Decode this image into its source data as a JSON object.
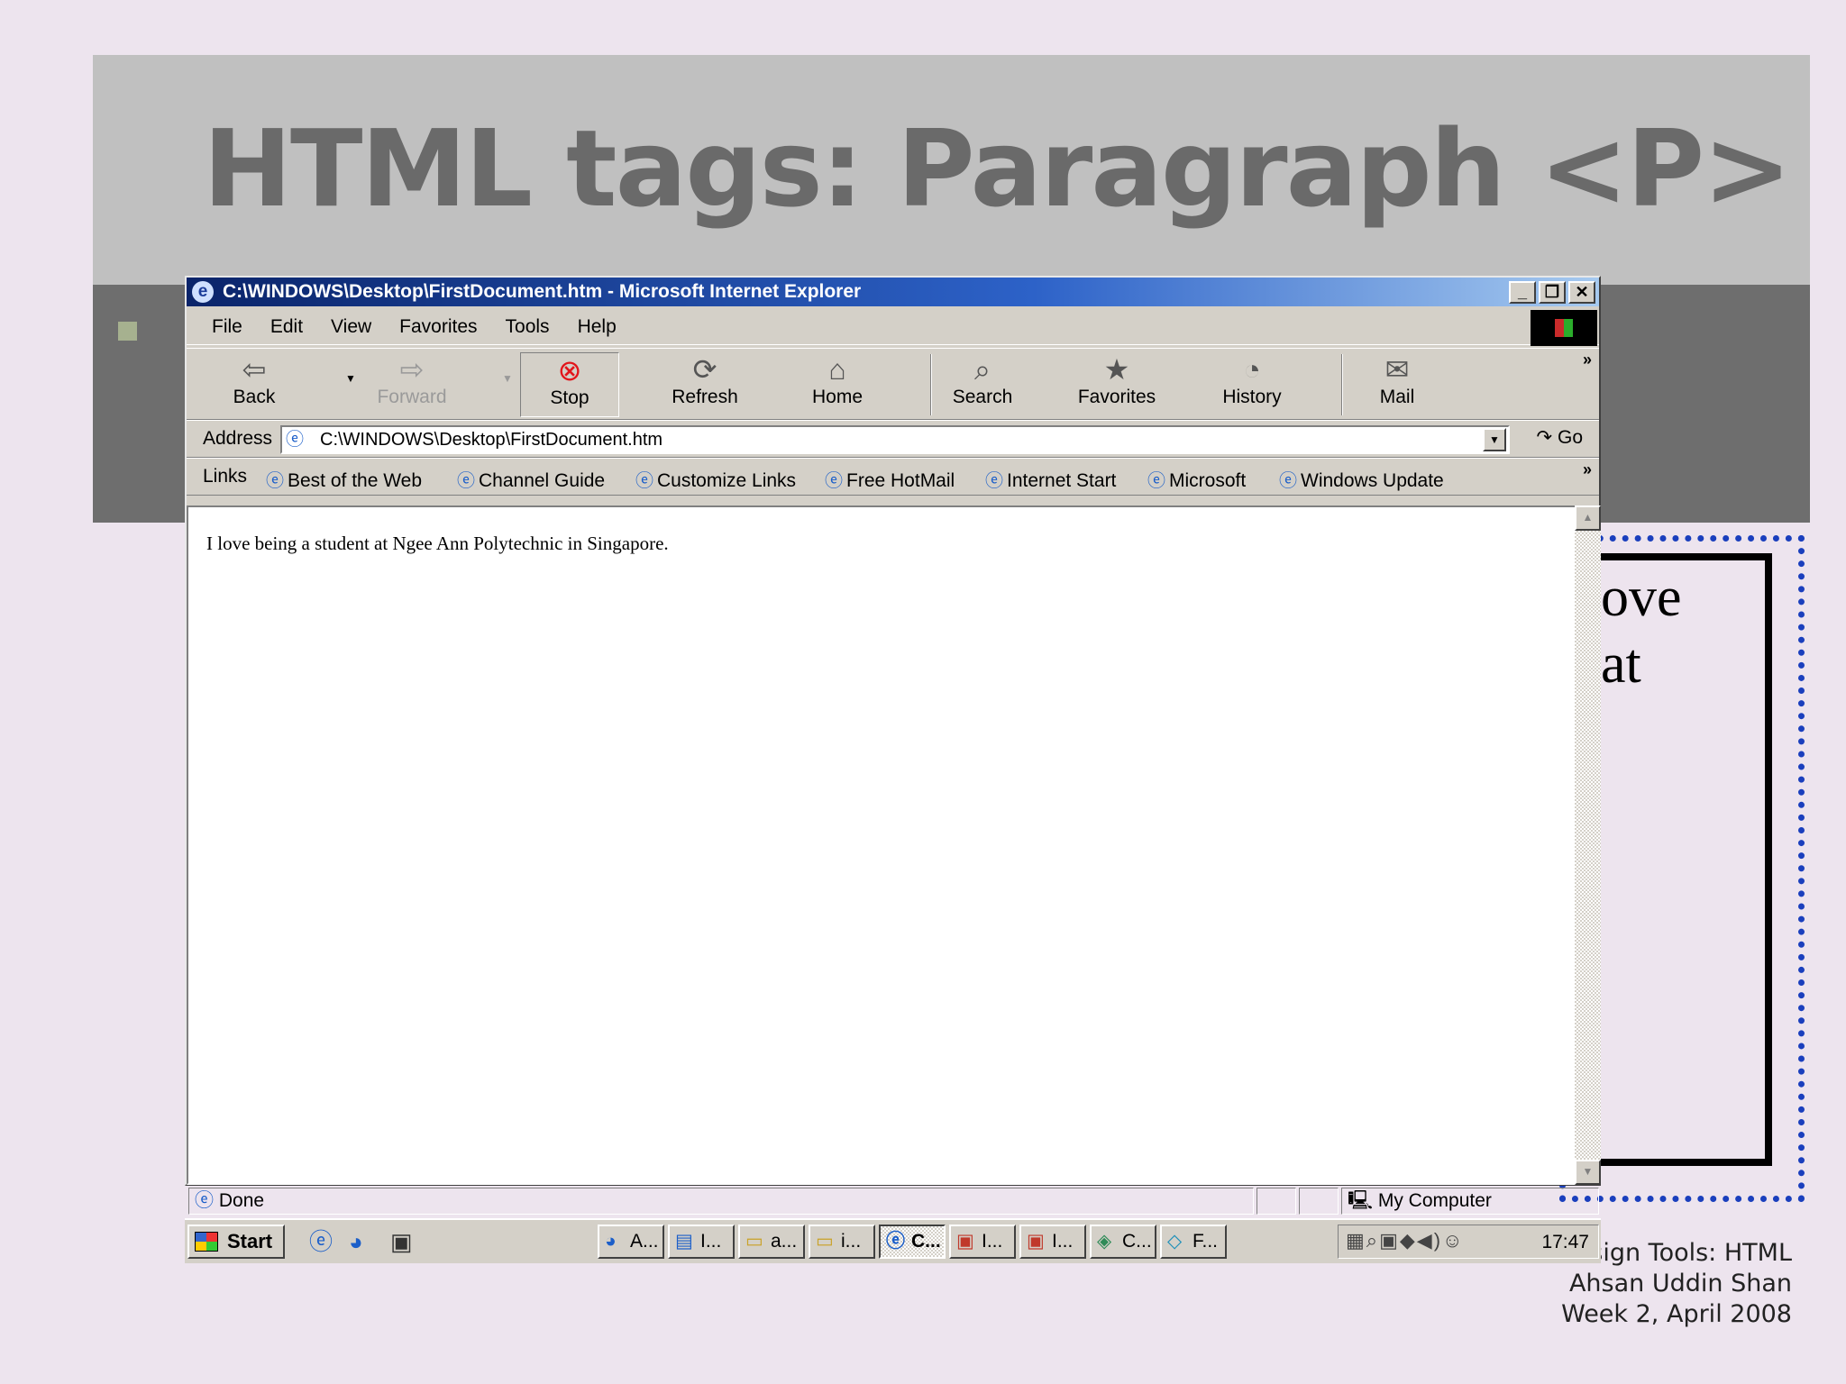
{
  "slide": {
    "title": "HTML tags: Paragraph <P>",
    "behind_text_line1": "ove",
    "behind_text_line2": "at",
    "footer_line1": "sign Tools: HTML",
    "footer_line2": "Ahsan Uddin Shan",
    "footer_line3": "Week 2, April 2008"
  },
  "window": {
    "title": "C:\\WINDOWS\\Desktop\\FirstDocument.htm - Microsoft Internet Explorer",
    "buttons": {
      "minimize": "_",
      "restore": "❐",
      "close": "✕"
    }
  },
  "menu": [
    "File",
    "Edit",
    "View",
    "Favorites",
    "Tools",
    "Help"
  ],
  "toolbar": {
    "back": "Back",
    "forward": "Forward",
    "stop": "Stop",
    "refresh": "Refresh",
    "home": "Home",
    "search": "Search",
    "favorites": "Favorites",
    "history": "History",
    "mail": "Mail",
    "more": "»"
  },
  "address": {
    "label": "Address",
    "value": "C:\\WINDOWS\\Desktop\\FirstDocument.htm",
    "go": "Go"
  },
  "links": {
    "label": "Links",
    "items": [
      "Best of the Web",
      "Channel Guide",
      "Customize Links",
      "Free HotMail",
      "Internet Start",
      "Microsoft",
      "Windows Update"
    ],
    "more": "»"
  },
  "page": {
    "text": "I love being a student at Ngee Ann Polytechnic in Singapore."
  },
  "status": {
    "text": "Done",
    "zone": "My Computer"
  },
  "taskbar": {
    "start": "Start",
    "tasks": [
      "A...",
      "I...",
      "a...",
      "i...",
      "C...",
      "I...",
      "I...",
      "C...",
      "F..."
    ],
    "clock": "17:47"
  }
}
